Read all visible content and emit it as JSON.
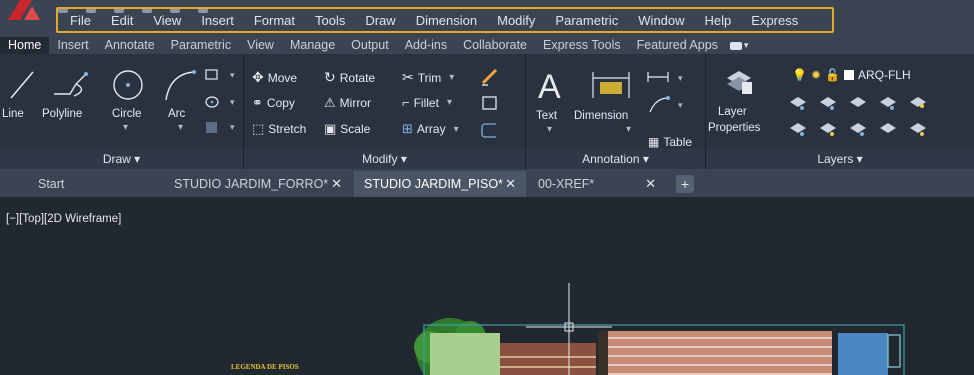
{
  "menu": {
    "items": [
      "File",
      "Edit",
      "View",
      "Insert",
      "Format",
      "Tools",
      "Draw",
      "Dimension",
      "Modify",
      "Parametric",
      "Window",
      "Help",
      "Express"
    ]
  },
  "ribbon_tabs": {
    "items": [
      "Home",
      "Insert",
      "Annotate",
      "Parametric",
      "View",
      "Manage",
      "Output",
      "Add-ins",
      "Collaborate",
      "Express Tools",
      "Featured Apps"
    ],
    "active": "Home"
  },
  "panels": {
    "draw": {
      "title": "Draw ▾",
      "line": "Line",
      "polyline": "Polyline",
      "circle": "Circle",
      "arc": "Arc"
    },
    "modify": {
      "title": "Modify ▾",
      "move": "Move",
      "rotate": "Rotate",
      "trim": "Trim",
      "copy": "Copy",
      "mirror": "Mirror",
      "fillet": "Fillet",
      "stretch": "Stretch",
      "scale": "Scale",
      "array": "Array"
    },
    "annotation": {
      "title": "Annotation ▾",
      "text": "Text",
      "dimension": "Dimension",
      "table": "Table"
    },
    "layers": {
      "title": "Layers ▾",
      "layer_properties_line1": "Layer",
      "layer_properties_line2": "Properties",
      "current_layer": "ARQ-FLH"
    }
  },
  "file_tabs": {
    "start": "Start",
    "tab1": "STUDIO JARDIM_FORRO*",
    "tab2": "STUDIO JARDIM_PISO*",
    "tab3": "00-XREF*",
    "close_glyph": "✕",
    "new_glyph": "+"
  },
  "canvas": {
    "viewport_label": "[−][Top][2D Wireframe]",
    "legend_title": "LEGENDA DE PISOS"
  },
  "colors": {
    "menu_highlight": "#e4a92b",
    "background": "#212830",
    "ribbon": "#2a323f",
    "legend_text": "#e5c333"
  }
}
